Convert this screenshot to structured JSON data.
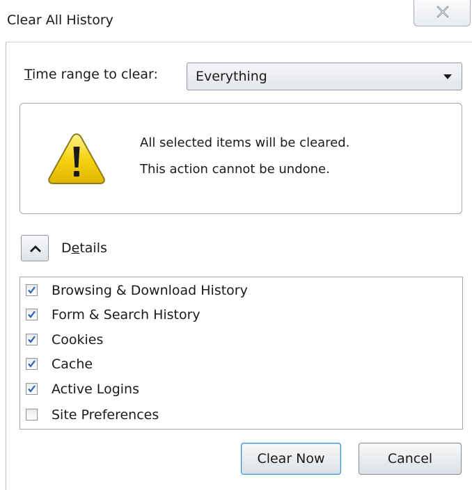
{
  "window": {
    "title": "Clear All History"
  },
  "time_range": {
    "label": "Time range to clear:",
    "label_accel": "T",
    "label_rest": "ime range to clear:",
    "selected": "Everything"
  },
  "warning": {
    "line1": "All selected items will be cleared.",
    "line2": "This action cannot be undone."
  },
  "details": {
    "label_pre": "D",
    "label_accel": "e",
    "label_rest": "tails",
    "expanded": true
  },
  "items": [
    {
      "label": "Browsing & Download History",
      "checked": true
    },
    {
      "label": "Form & Search History",
      "checked": true
    },
    {
      "label": "Cookies",
      "checked": true
    },
    {
      "label": "Cache",
      "checked": true
    },
    {
      "label": "Active Logins",
      "checked": true
    },
    {
      "label": "Site Preferences",
      "checked": false
    }
  ],
  "buttons": {
    "clear_now": "Clear Now",
    "cancel": "Cancel"
  },
  "icons": {
    "close": "close-icon",
    "warning": "warning-icon",
    "collapse": "chevron-up-icon",
    "dropdown": "chevron-down-icon",
    "check": "check-icon"
  },
  "colors": {
    "warning_fill": "#f5d312",
    "warning_border": "#8a7a20",
    "check": "#2f5fb3",
    "default_button_border": "#3d8fd4"
  }
}
